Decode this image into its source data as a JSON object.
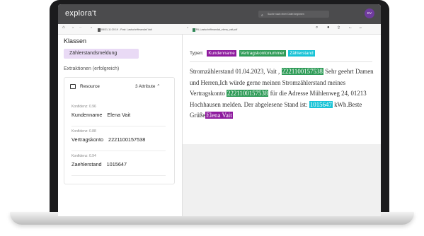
{
  "colors": {
    "kundenname": "#8e1a9e",
    "vertragskonto": "#2e9b57",
    "zaehlerstand": "#18c3d6",
    "class_chip_bg": "#e9daf5",
    "topbar": "#4b4b4d"
  },
  "app": {
    "logo": "explora't",
    "search_placeholder": "Suche nach einer Datei beginnen",
    "avatar_initials": "EV"
  },
  "breadcrumb": {
    "home_icon": "home-icon",
    "ellipsis": "···",
    "folder": "23/08/31-11:20:19 - Post: Lastschriftmandat Vait",
    "separator": ">",
    "file": "SEPA-Lastschriftmandat_elena_vait.pdf"
  },
  "left": {
    "klassen_title": "Klassen",
    "class_label": "Zählerstandsmeldung",
    "extraktionen_title": "Extraktionen (erfolgreich)",
    "resource": {
      "name": "Resource",
      "attr_count": "3 Attribute",
      "attributes": [
        {
          "confidence": "Konfidenz: 0.96",
          "key": "Kundenname",
          "value": "Elena Vait"
        },
        {
          "confidence": "Konfidenz: 0.88",
          "key": "Vertragskonto",
          "value": "2221100157538"
        },
        {
          "confidence": "Konfidenz: 0.94",
          "key": "Zaehlerstand",
          "value": "1015647"
        }
      ]
    }
  },
  "right": {
    "types_label": "Typen:",
    "types": [
      "Kundenname",
      "Vertragskontonummer",
      "Zählerstand"
    ],
    "doc": {
      "p1": "Stromzählerstand 01.04.2023, Vait , ",
      "hl1": "2221100157538",
      "p2": " Sehr geehrt Damen und Herren,Ich würde gerne meinen Stromzählerstand meines Vertragskonto ",
      "hl2": "2221100157538",
      "p3": " für die Adresse Mühlenweg 24, 01213 Hochhausen melden. Der abgelesene Stand ist: ",
      "hl3": "1015647",
      "p4": " kWh.Beste Grüße",
      "hl4": "Elena Vait"
    }
  }
}
